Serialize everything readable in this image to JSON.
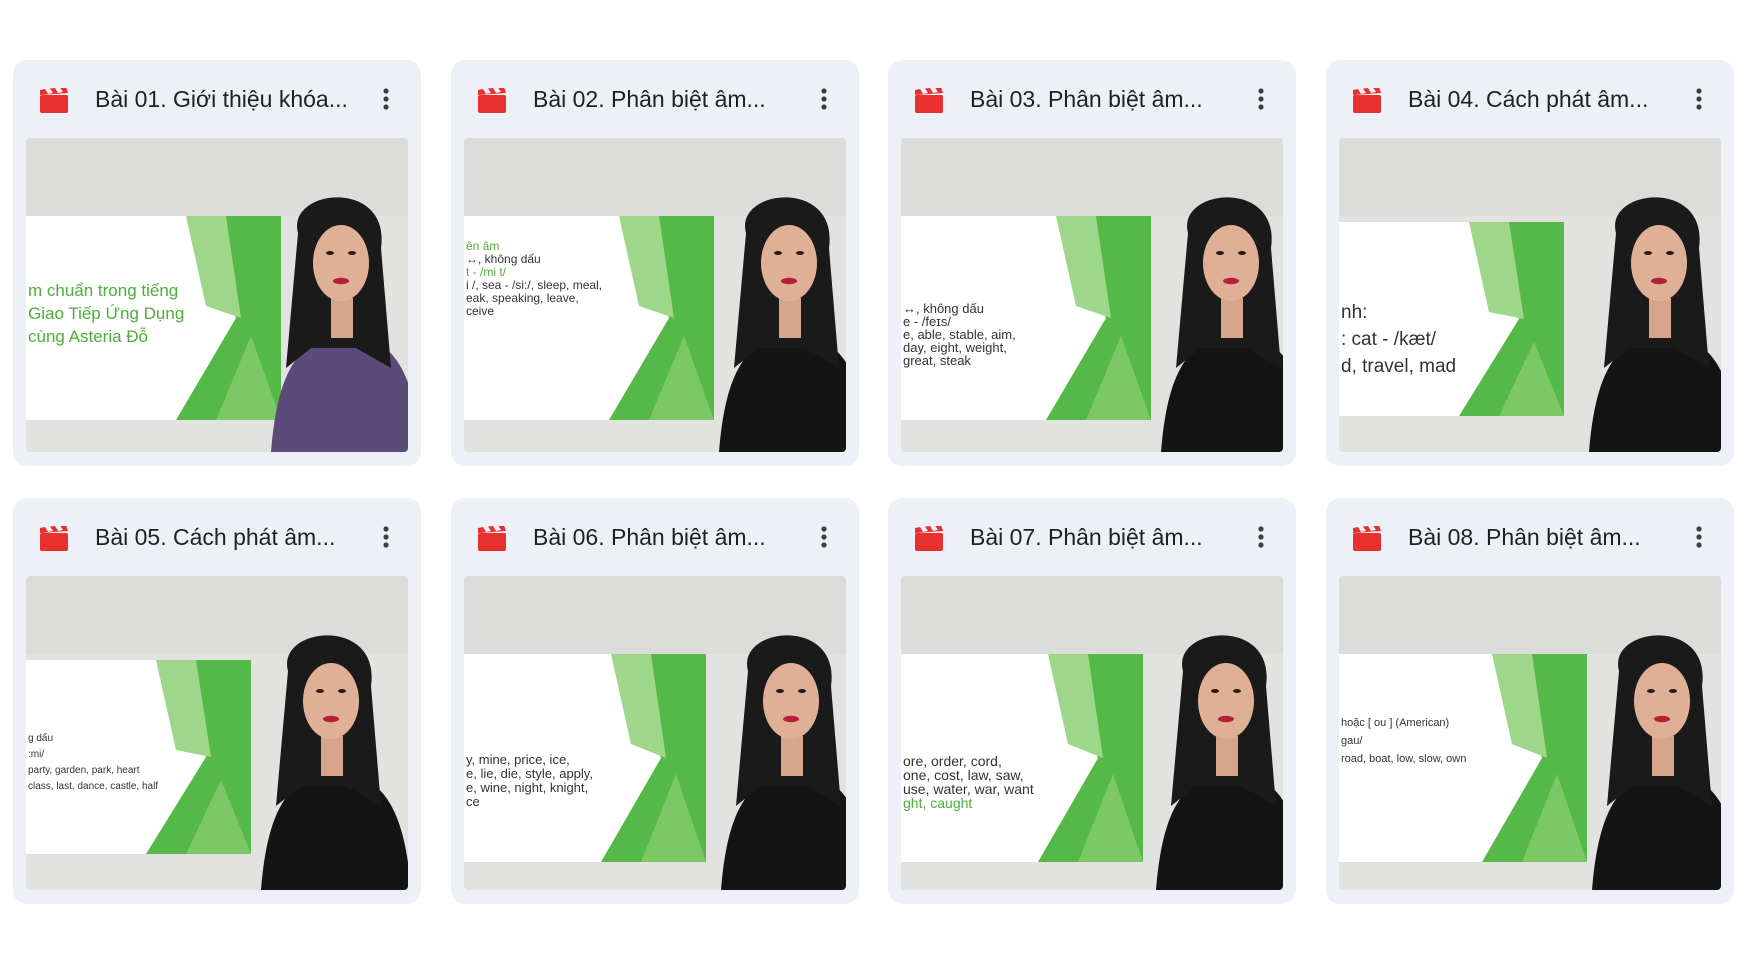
{
  "colors": {
    "card_bg": "#edf1f7",
    "video_icon": "#e8302f",
    "slide_green": "#55b947",
    "slide_green_light": "#9ed68a",
    "slide_text_green": "#4caf3a",
    "title_text": "#202124"
  },
  "icons": {
    "file_type": "video-file-icon",
    "menu": "more-vert-icon"
  },
  "files": [
    {
      "title": "Bài 01. Giới thiệu khóa...",
      "slide_lines": [
        {
          "text": "m chuẩn trong tiếng",
          "color": "#4caf3a"
        },
        {
          "text": "Giao Tiếp Ứng Dụng",
          "color": "#4caf3a"
        },
        {
          "text": "cùng Asteria Đỗ",
          "color": "#4caf3a"
        }
      ]
    },
    {
      "title": "Bài 02. Phân biệt âm...",
      "slide_lines": [
        {
          "text": "ên âm",
          "color": "#4caf3a"
        },
        {
          "text": "↔, không dấu",
          "color": "#333333"
        },
        {
          "text": "t - /mi t/",
          "color": "#4caf3a"
        },
        {
          "text": "i /, sea - /si:/, sleep, meal,",
          "color": "#333333"
        },
        {
          "text": "eak, speaking, leave,",
          "color": "#333333"
        },
        {
          "text": "ceive",
          "color": "#333333"
        }
      ]
    },
    {
      "title": "Bài 03. Phân biệt âm...",
      "slide_lines": [
        {
          "text": "↔, không dấu",
          "color": "#333333"
        },
        {
          "text": "e - /feɪs/",
          "color": "#333333"
        },
        {
          "text": "e, able, stable, aim,",
          "color": "#333333"
        },
        {
          "text": "day, eight, weight,",
          "color": "#333333"
        },
        {
          "text": "great, steak",
          "color": "#333333"
        }
      ]
    },
    {
      "title": "Bài 04. Cách phát âm...",
      "slide_lines": [
        {
          "text": "nh:",
          "color": "#333333"
        },
        {
          "text": ": cat - /kæt/",
          "color": "#333333"
        },
        {
          "text": "d, travel, mad",
          "color": "#333333"
        }
      ]
    },
    {
      "title": "Bài 05. Cách phát âm...",
      "slide_lines": [
        {
          "text": "g dấu",
          "color": "#333333"
        },
        {
          "text": ":mi/",
          "color": "#333333"
        },
        {
          "text": "party, garden, park, heart",
          "color": "#333333"
        },
        {
          "text": "class, last, dance, castle, half",
          "color": "#333333"
        }
      ]
    },
    {
      "title": "Bài 06. Phân biệt âm...",
      "slide_lines": [
        {
          "text": "y, mine, price, ice,",
          "color": "#333333"
        },
        {
          "text": "e, lie, die, style, apply,",
          "color": "#333333"
        },
        {
          "text": "e, wine, night, knight,",
          "color": "#333333"
        },
        {
          "text": "ce",
          "color": "#333333"
        }
      ]
    },
    {
      "title": "Bài 07. Phân biệt âm...",
      "slide_lines": [
        {
          "text": "ore, order, cord,",
          "color": "#333333"
        },
        {
          "text": "one, cost, law, saw,",
          "color": "#333333"
        },
        {
          "text": "use, water, war, want",
          "color": "#333333"
        },
        {
          "text": "ght, caught",
          "color": "#4caf3a"
        }
      ]
    },
    {
      "title": "Bài 08. Phân biệt âm...",
      "slide_lines": [
        {
          "text": "hoặc [ ou ] (American)",
          "color": "#333333"
        },
        {
          "text": "gau/",
          "color": "#333333"
        },
        {
          "text": "road, boat, low, slow, own",
          "color": "#333333"
        }
      ]
    }
  ]
}
